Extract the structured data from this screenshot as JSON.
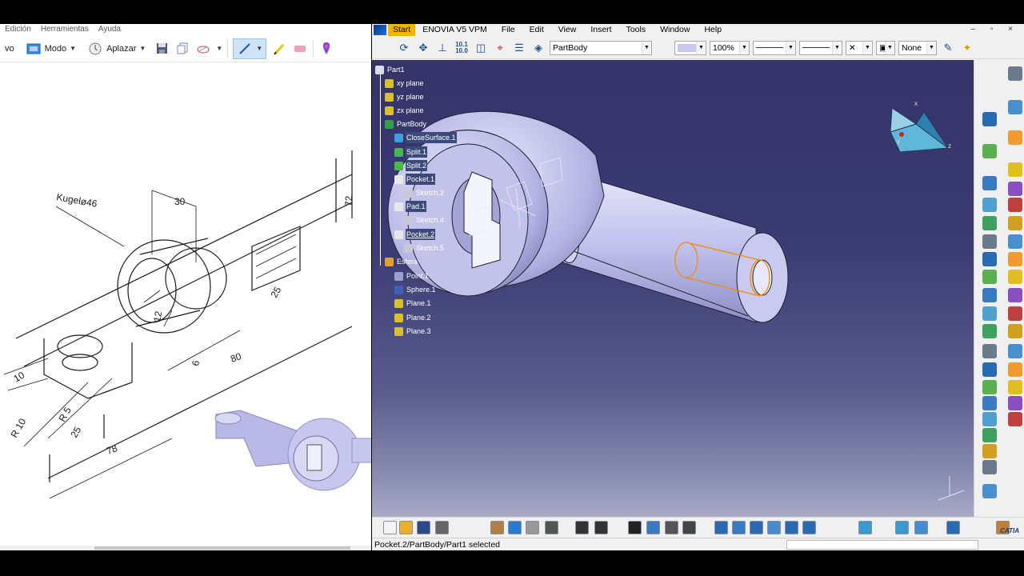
{
  "left_app": {
    "menu": [
      "Edición",
      "Herramientas",
      "Ayuda"
    ],
    "toolbar": {
      "new_partial": "vo",
      "mode_label": "Modo",
      "delay_label": "Aplazar"
    },
    "drawing_labels": {
      "sphere": "Kugelø46",
      "d30": "30",
      "d72": "72",
      "d25a": "25",
      "d25b": "25",
      "d80": "80",
      "d78": "78",
      "r10": "R 10",
      "r5": "R 5",
      "d10": "10",
      "d6": "6",
      "d12": "12"
    }
  },
  "catia": {
    "menu": [
      "Start",
      "ENOVIA V5 VPM",
      "File",
      "Edit",
      "View",
      "Insert",
      "Tools",
      "Window",
      "Help"
    ],
    "window_controls": "– ▫ ×",
    "toolbar": {
      "body_combo": "PartBody",
      "zoom_combo": "100%",
      "layer_combo": "None"
    },
    "tree": {
      "root": "Part1",
      "items": [
        {
          "label": "xy plane",
          "level": 1,
          "icon": "plane-icon"
        },
        {
          "label": "yz plane",
          "level": 1,
          "icon": "plane-icon"
        },
        {
          "label": "zx plane",
          "level": 1,
          "icon": "plane-icon"
        },
        {
          "label": "PartBody",
          "level": 1,
          "icon": "body-icon"
        },
        {
          "label": "CloseSurface.1",
          "level": 2,
          "icon": "close-surface-icon"
        },
        {
          "label": "Split.1",
          "level": 2,
          "icon": "split-icon"
        },
        {
          "label": "Split.2",
          "level": 2,
          "icon": "split-icon"
        },
        {
          "label": "Pocket.1",
          "level": 2,
          "icon": "pocket-icon"
        },
        {
          "label": "Sketch.2",
          "level": 3,
          "icon": "sketch-icon"
        },
        {
          "label": "Pad.1",
          "level": 2,
          "icon": "pad-icon"
        },
        {
          "label": "Sketch.4",
          "level": 3,
          "icon": "sketch-icon"
        },
        {
          "label": "Pocket.2",
          "level": 2,
          "icon": "pocket-icon",
          "selected": true
        },
        {
          "label": "Sketch.5",
          "level": 3,
          "icon": "sketch-icon"
        },
        {
          "label": "Esfera",
          "level": 1,
          "icon": "geoset-icon"
        },
        {
          "label": "Point.1",
          "level": 2,
          "icon": "point-icon"
        },
        {
          "label": "Sphere.1",
          "level": 2,
          "icon": "sphere-icon"
        },
        {
          "label": "Plane.1",
          "level": 2,
          "icon": "plane-icon"
        },
        {
          "label": "Plane.2",
          "level": 2,
          "icon": "plane-icon"
        },
        {
          "label": "Plane.3",
          "level": 2,
          "icon": "plane-icon"
        }
      ]
    },
    "compass_labels": {
      "x": "x",
      "y": "y",
      "z": "z"
    },
    "status_text": "Pocket.2/PartBody/Part1 selected",
    "brand": "CATIA",
    "colors": {
      "menu_start": "#f5b400",
      "selection": "#f28c00",
      "part_surface": "#c8c8f0",
      "viewport_top": "#34336a"
    }
  }
}
